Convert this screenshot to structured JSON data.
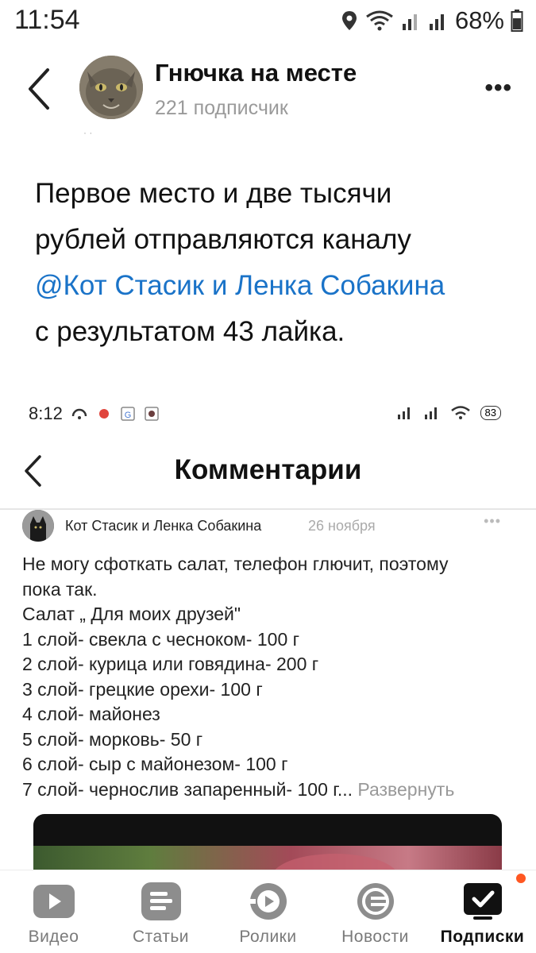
{
  "status_bar": {
    "time": "11:54",
    "battery": "68%"
  },
  "header": {
    "channel_name": "Гнючка на месте",
    "subscribers": "221  подписчик"
  },
  "post": {
    "line1": "Первое место и две тысячи",
    "line2": "рублей отправляются каналу",
    "mention": "@Кот Стасик и Ленка Собакина",
    "line4": "с результатом 43 лайка."
  },
  "embedded": {
    "status_time": "8:12",
    "battery": "83",
    "title": "Комментарии",
    "comment": {
      "author": "Кот Стасик и Ленка Собакина",
      "date": "26 ноября",
      "lines": [
        "Не могу сфоткать салат, телефон глючит, поэтому",
        "пока так.",
        "Салат „ Для моих друзей\"",
        "1 слой- свекла с чесноком- 100 г",
        "2 слой- курица или говядина- 200 г",
        "3 слой- грецкие орехи- 100 г",
        "4 слой- майонез",
        "5 слой- морковь- 50 г",
        "6 слой- сыр с майонезом- 100 г",
        "7 слой- чернослив запаренный- 100 г..."
      ],
      "expand": "Развернуть"
    }
  },
  "nav": {
    "video": "Видео",
    "articles": "Статьи",
    "reels": "Ролики",
    "news": "Новости",
    "subscriptions": "Подписки"
  },
  "colors": {
    "accent_link": "#1a73c8",
    "notif_dot": "#ff5722"
  }
}
